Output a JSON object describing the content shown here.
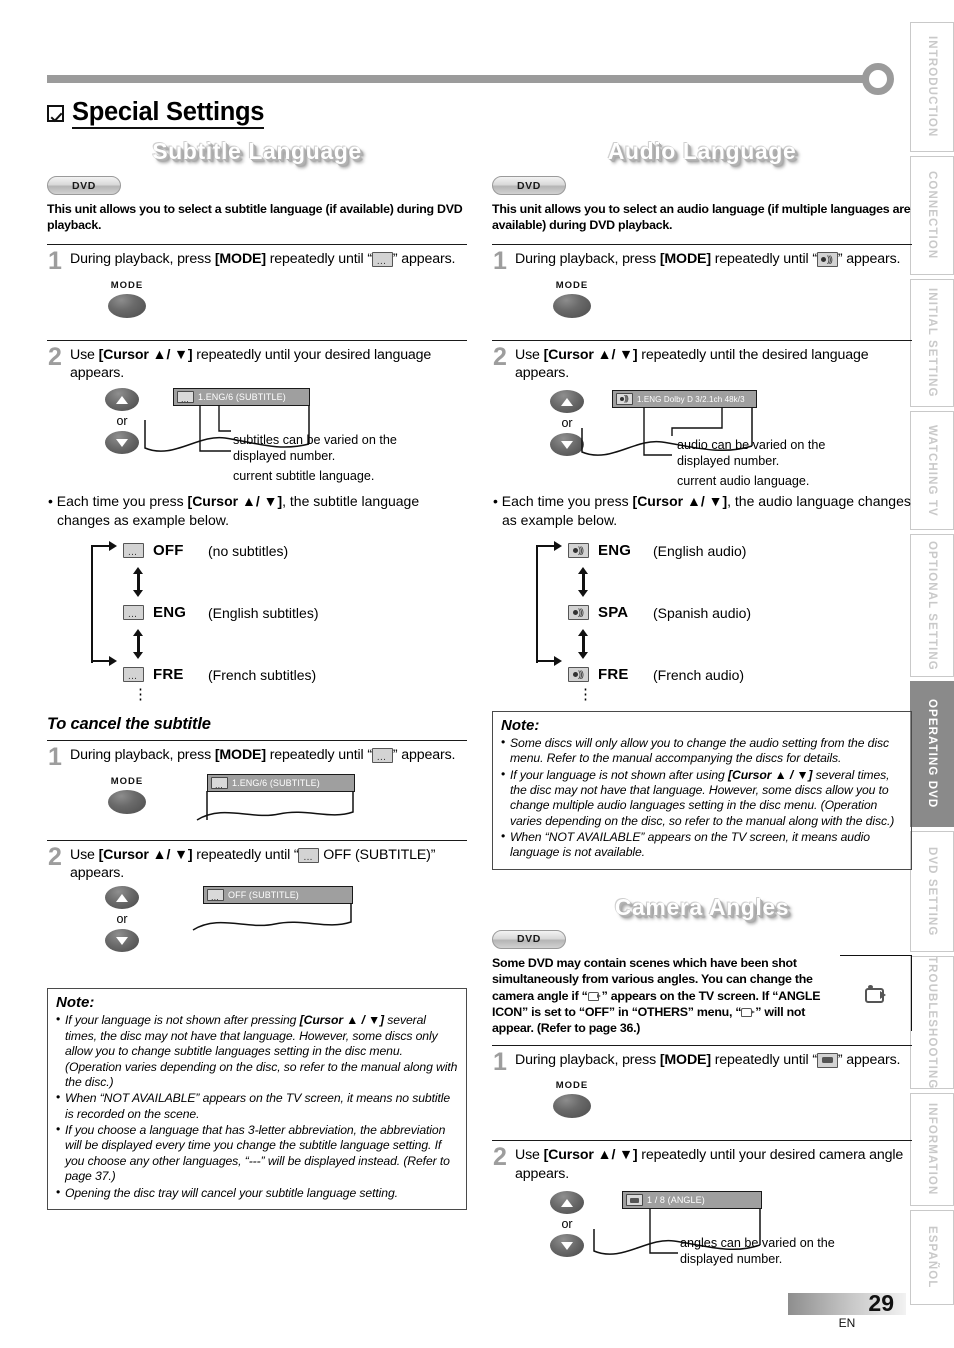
{
  "main_title": "Special Settings",
  "footer": {
    "page_number": "29",
    "lang": "EN"
  },
  "side_tabs": [
    {
      "label": "INTRODUCTION",
      "active": false
    },
    {
      "label": "CONNECTION",
      "active": false
    },
    {
      "label": "INITIAL  SETTING",
      "active": false
    },
    {
      "label": "WATCHING  TV",
      "active": false
    },
    {
      "label": "OPTIONAL  SETTING",
      "active": false
    },
    {
      "label": "OPERATING  DVD",
      "active": true
    },
    {
      "label": "DVD  SETTING",
      "active": false
    },
    {
      "label": "TROUBLESHOOTING",
      "active": false
    },
    {
      "label": "INFORMATION",
      "active": false
    },
    {
      "label": "ESPAÑOL",
      "active": false
    }
  ],
  "subtitle_language": {
    "banner": "Subtitle Language",
    "badge": "DVD",
    "intro": "This unit allows you to select a subtitle language (if available) during DVD playback.",
    "step1": {
      "num": "1",
      "text_a": "During playback, press ",
      "text_b": "[MODE]",
      "text_c": " repeatedly until “",
      "text_d": "” appears.",
      "mode_label": "MODE"
    },
    "step2": {
      "num": "2",
      "text_a": "Use ",
      "text_b": "[Cursor ▲/ ▼]",
      "text_c": " repeatedly until your desired language appears.",
      "or": "or",
      "osd_text": "1.ENG/6  (SUBTITLE)",
      "callout_1": "subtitles can be varied on the displayed number.",
      "callout_2": "current subtitle language.",
      "bullet_a": "Each time you press ",
      "bullet_b": "[Cursor ▲/ ▼]",
      "bullet_c": ", the subtitle language changes as example below."
    },
    "cycle": [
      {
        "code": "OFF",
        "desc": "(no subtitles)"
      },
      {
        "code": "ENG",
        "desc": "(English subtitles)"
      },
      {
        "code": "FRE",
        "desc": "(French subtitles)"
      }
    ],
    "cancel_heading": "To cancel the subtitle",
    "cancel_step1": {
      "num": "1",
      "text_a": "During playback, press ",
      "text_b": "[MODE]",
      "text_c": " repeatedly until “",
      "text_d": "” appears.",
      "mode_label": "MODE",
      "osd_text": "1.ENG/6  (SUBTITLE)"
    },
    "cancel_step2": {
      "num": "2",
      "text_a": "Use ",
      "text_b": "[Cursor ▲/ ▼]",
      "text_c": " repeatedly until “",
      "text_d": " OFF (SUBTITLE)” appears.",
      "or": "or",
      "osd_text": "OFF  (SUBTITLE)"
    },
    "note": {
      "title": "Note:",
      "items": [
        {
          "pre": "If your language is not shown after pressing ",
          "bold": "[Cursor ▲ / ▼]",
          "post": " several times, the disc may not have that language. However, some discs only allow you to change subtitle languages setting in the disc menu. (Operation varies depending on the disc, so refer to the manual along with the disc.)"
        },
        {
          "pre": "When “NOT AVAILABLE” appears on the TV screen, it means no subtitle is recorded on the scene.",
          "bold": "",
          "post": ""
        },
        {
          "pre": "If you choose a language that has 3-letter abbreviation, the abbreviation will be displayed every time you change the subtitle language setting. If you choose any other languages, “---” will be displayed instead. (Refer to page 37.)",
          "bold": "",
          "post": ""
        },
        {
          "pre": "Opening the disc tray will cancel your subtitle language setting.",
          "bold": "",
          "post": ""
        }
      ]
    }
  },
  "audio_language": {
    "banner": "Audio Language",
    "badge": "DVD",
    "intro": "This unit allows you to select an audio language (if multiple languages are available) during DVD playback.",
    "step1": {
      "num": "1",
      "text_a": "During playback, press ",
      "text_b": "[MODE]",
      "text_c": " repeatedly until “",
      "text_d": "” appears.",
      "mode_label": "MODE"
    },
    "step2": {
      "num": "2",
      "text_a": "Use ",
      "text_b": "[Cursor ▲/ ▼]",
      "text_c": " repeatedly until the desired language appears.",
      "or": "or",
      "osd_text": "1.ENG Dolby D 3/2.1ch  48k/3",
      "callout_1": "audio can be varied on the displayed number.",
      "callout_2": "current audio language.",
      "bullet_a": "Each time you press ",
      "bullet_b": "[Cursor ▲/ ▼]",
      "bullet_c": ", the audio language changes as example below."
    },
    "cycle": [
      {
        "code": "ENG",
        "desc": "(English audio)"
      },
      {
        "code": "SPA",
        "desc": "(Spanish audio)"
      },
      {
        "code": "FRE",
        "desc": "(French audio)"
      }
    ],
    "note": {
      "title": "Note:",
      "items": [
        {
          "pre": "Some discs will only allow you to change the audio setting from the disc menu. Refer to the manual accompanying the discs for details.",
          "bold": "",
          "post": ""
        },
        {
          "pre": "If your language is not shown after using ",
          "bold": "[Cursor ▲ / ▼]",
          "post": " several times, the disc may not have that language. However, some discs allow you to change multiple audio languages setting in the disc menu. (Operation varies depending on the disc, so refer to the manual along with the disc.)"
        },
        {
          "pre": "When “NOT AVAILABLE” appears on the TV screen, it means audio language is not available.",
          "bold": "",
          "post": ""
        }
      ]
    }
  },
  "camera_angles": {
    "banner": "Camera Angles",
    "badge": "DVD",
    "intro_1": "Some DVD may contain scenes which have been shot simultaneously from various angles. You can change the camera angle if “",
    "intro_2": "” appears on the TV screen. If “ANGLE ICON” is set to “OFF” in “OTHERS” menu, “",
    "intro_3": "” will not appear. (Refer to page 36.)",
    "step1": {
      "num": "1",
      "text_a": "During playback, press ",
      "text_b": "[MODE]",
      "text_c": " repeatedly until “",
      "text_d": "” appears.",
      "mode_label": "MODE"
    },
    "step2": {
      "num": "2",
      "text_a": "Use ",
      "text_b": "[Cursor ▲/ ▼]",
      "text_c": " repeatedly until your desired camera angle appears.",
      "or": "or",
      "osd_text": "1 / 8  (ANGLE)",
      "callout_1": "angles  can  be  varied  on the displayed number."
    }
  }
}
